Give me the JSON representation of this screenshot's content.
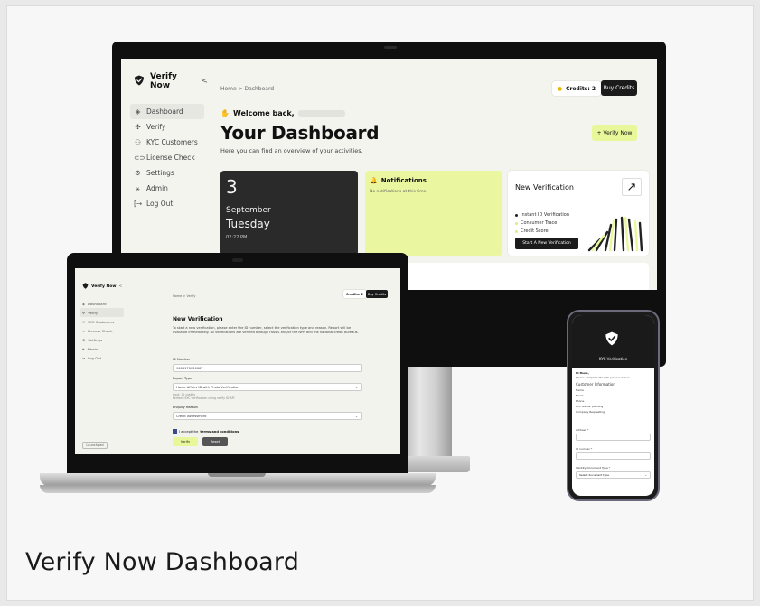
{
  "caption": "Verify Now Dashboard",
  "brand": {
    "name": "Verify Now",
    "collapse": "<",
    "accent": "#e9f79b",
    "dark": "#1b1b1b"
  },
  "monitor": {
    "nav": [
      {
        "label": "Dashboard",
        "icon": "dashboard-icon",
        "glyph": "◈"
      },
      {
        "label": "Verify",
        "icon": "verify-icon",
        "glyph": "✣"
      },
      {
        "label": "KYC Customers",
        "icon": "users-icon",
        "glyph": "⚇"
      },
      {
        "label": "License Check",
        "icon": "car-icon",
        "glyph": "⊂⊃"
      },
      {
        "label": "Settings",
        "icon": "gear-icon",
        "glyph": "⚙"
      },
      {
        "label": "Admin",
        "icon": "admin-icon",
        "glyph": "⚹"
      },
      {
        "label": "Log Out",
        "icon": "logout-icon",
        "glyph": "[→"
      }
    ],
    "breadcrumb": "Home  >  Dashboard",
    "credits": "Credits: 2",
    "buy": "Buy Credits",
    "welcome": "Welcome back,",
    "title": "Your Dashboard",
    "subtitle": "Here you can find an overview of your activities.",
    "verify_now": "+ Verify Now",
    "date": {
      "day_num": "3",
      "month": "September",
      "weekday": "Tuesday",
      "time": "02:22 PM"
    },
    "notifications": {
      "title": "Notifications",
      "empty": "No notifications at this time."
    },
    "new_verification": {
      "title": "New Verification",
      "items": [
        "Instant ID Verification",
        "Consumer Trace",
        "Credit Score"
      ],
      "button": "Start A New Verification"
    }
  },
  "laptop": {
    "nav": [
      "Dashboard",
      "Verify",
      "KYC Customers",
      "License Check",
      "Settings",
      "Admin",
      "Log Out"
    ],
    "launchpad": "Launchpad",
    "breadcrumb": "Home  >  Verify",
    "credits": "Credits: 2",
    "buy": "Buy Credits",
    "title": "New Verification",
    "intro": "To start a new verification, please enter the ID number, select the verification type and reason. Report will be available immediately. All verifications are verified through HANIS and/or the NPR and the national credit bureaus.",
    "id_label": "ID Number",
    "id_value": "9606170020087",
    "report_label": "Report Type",
    "report_value": "Home Affairs ID with Photo Verification",
    "report_hint": "Cost: 10 credits\nPerform KYC verification using verify ID API",
    "enquiry_label": "Enquiry Reason",
    "enquiry_value": "Credit Assessment",
    "terms_prefix": "I accept the",
    "terms_link": "terms and conditions",
    "verify": "Verify",
    "reset": "Reset"
  },
  "phone": {
    "title": "KYC Verification",
    "hi": "Hi there,",
    "note": "Please complete the KYC process below",
    "section": "Customer Information",
    "rows": [
      "Name",
      "Email",
      "Phone",
      "KYC Status: pending",
      "Company Requesting"
    ],
    "address_label": "Address *",
    "id_label": "ID number *",
    "doc_label": "Identity Document Type *",
    "doc_placeholder": "Select document type"
  }
}
